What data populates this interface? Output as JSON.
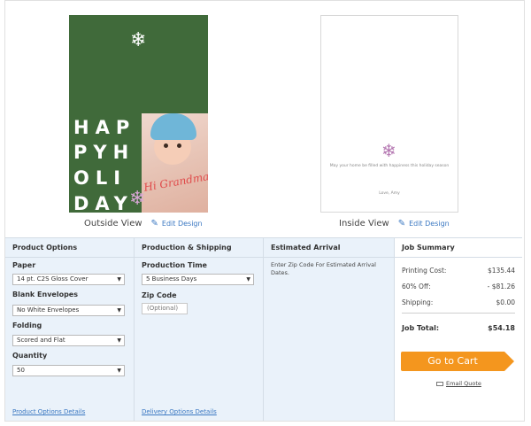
{
  "preview": {
    "outside": {
      "holiday_lines": [
        "HAP",
        "PYH",
        "OLI",
        "DAY"
      ],
      "photo_caption": "Hi Grandma!",
      "view_label": "Outside View",
      "edit_label": "Edit Design"
    },
    "inside": {
      "message": "May your home be filled with happiness this holiday season",
      "signature": "Love, Amy",
      "view_label": "Inside View",
      "edit_label": "Edit Design"
    }
  },
  "product_options": {
    "header": "Product Options",
    "paper_label": "Paper",
    "paper_value": "14 pt. C2S Gloss Cover",
    "envelopes_label": "Blank Envelopes",
    "envelopes_value": "No White Envelopes",
    "folding_label": "Folding",
    "folding_value": "Scored and Flat",
    "quantity_label": "Quantity",
    "quantity_value": "50",
    "details_link": "Product Options Details"
  },
  "production": {
    "header": "Production & Shipping",
    "time_label": "Production Time",
    "time_value": "5 Business Days",
    "zip_label": "Zip Code",
    "zip_placeholder": "(Optional)",
    "details_link": "Delivery Options Details"
  },
  "arrival": {
    "header": "Estimated Arrival",
    "text": "Enter Zip Code For Estimated Arrival Dates."
  },
  "summary": {
    "header": "Job Summary",
    "printing_label": "Printing Cost:",
    "printing_value": "$135.44",
    "discount_label": "60% Off:",
    "discount_value": "- $81.26",
    "shipping_label": "Shipping:",
    "shipping_value": "$0.00",
    "total_label": "Job Total:",
    "total_value": "$54.18",
    "cart_label": "Go to Cart",
    "email_label": "Email Quote"
  },
  "colors": {
    "card_green": "#406a3a",
    "accent_orange": "#f4961e",
    "link_blue": "#3b78c2",
    "panel_blue": "#eaf2fa"
  }
}
